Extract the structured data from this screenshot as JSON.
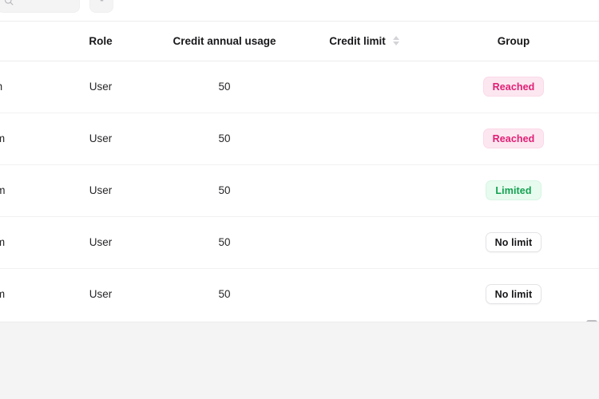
{
  "toolbar": {
    "search": {
      "icon": "search-icon",
      "value": "",
      "placeholder": ""
    },
    "filter_button": {
      "icon": "filter-icon",
      "label": ""
    }
  },
  "table": {
    "columns": [
      {
        "key": "email",
        "label": "",
        "sortable": false
      },
      {
        "key": "role",
        "label": "Role",
        "sortable": false
      },
      {
        "key": "usage",
        "label": "Credit annual usage",
        "sortable": false
      },
      {
        "key": "limit",
        "label": "Credit limit",
        "sortable": true,
        "sort_icon": "sort-arrows-icon"
      },
      {
        "key": "group",
        "label": "Group",
        "sortable": false
      }
    ],
    "rows": [
      {
        "email": "Schmitt@gmail.com",
        "role": "User",
        "usage": "50",
        "limit": "",
        "group": {
          "label": "Reached",
          "variant": "reached"
        }
      },
      {
        "email": "er Erson@gmail.com",
        "role": "User",
        "usage": "50",
        "limit": "",
        "group": {
          "label": "Reached",
          "variant": "reached"
        }
      },
      {
        "email": "me Lach@gmail.com",
        "role": "User",
        "usage": "50",
        "limit": "",
        "group": {
          "label": "Limited",
          "variant": "limited"
        }
      },
      {
        "email": "er Erson@gmail.com",
        "role": "User",
        "usage": "50",
        "limit": "",
        "group": {
          "label": "No limit",
          "variant": "nolimit"
        }
      },
      {
        "email": "er Erson@gmail.com",
        "role": "User",
        "usage": "50",
        "limit": "",
        "group": {
          "label": "No limit",
          "variant": "nolimit"
        }
      }
    ]
  },
  "scrollbar": {
    "orientation": "horizontal",
    "name": "table-horizontal-scrollbar"
  },
  "colors": {
    "page_background": "#f4f4f5",
    "card_background": "#ffffff",
    "row_divider": "#f1f1f2",
    "header_text": "#18181b",
    "body_text": "#27272a",
    "badge_reached_bg": "#fce7f0",
    "badge_reached_text": "#e11d74",
    "badge_limited_bg": "#e8fbef",
    "badge_limited_text": "#12a150",
    "badge_nolimit_bg": "#ffffff",
    "badge_nolimit_border": "#e4e4e7",
    "sort_arrow": "#d4d4d8",
    "scrollbar_thumb": "#bdbdc2"
  }
}
